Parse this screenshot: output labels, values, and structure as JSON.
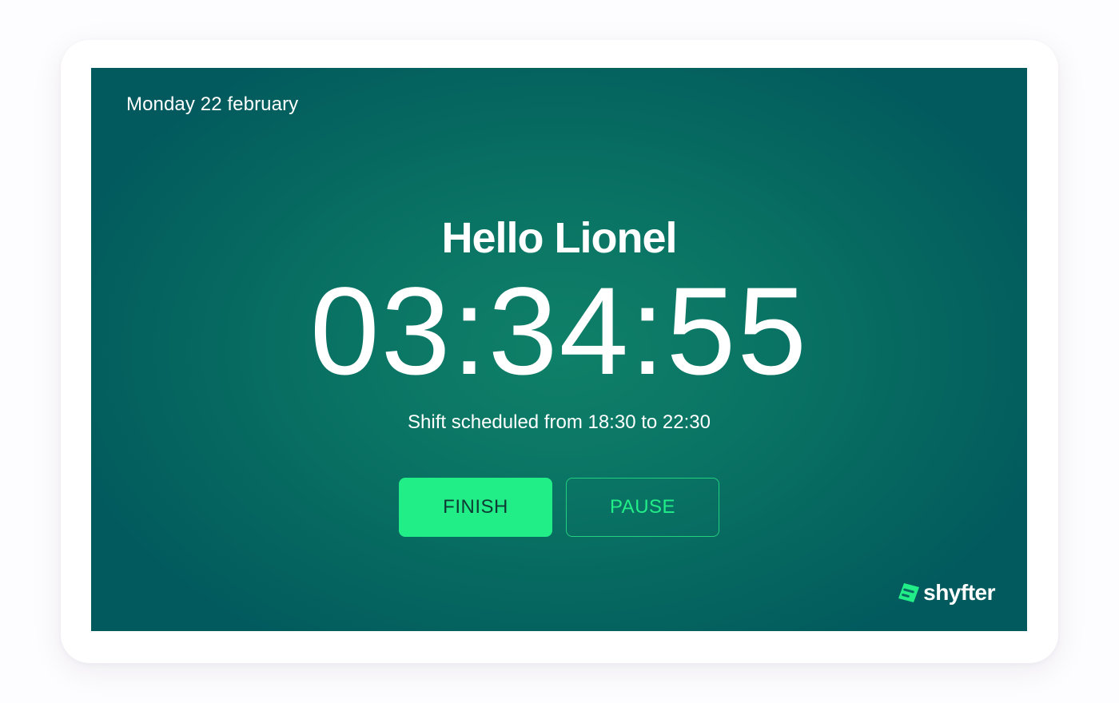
{
  "screen": {
    "date": "Monday 22 february",
    "greeting": "Hello Lionel",
    "timer": "03:34:55",
    "shift_info": "Shift scheduled from 18:30 to 22:30"
  },
  "actions": {
    "finish_label": "FINISH",
    "pause_label": "PAUSE"
  },
  "brand": {
    "name": "shyfter",
    "icon": "shyfter-logo-icon"
  },
  "colors": {
    "background": "#0a7464",
    "accent": "#22ee88",
    "finish_text": "#0d3b33",
    "text": "#ffffff"
  }
}
